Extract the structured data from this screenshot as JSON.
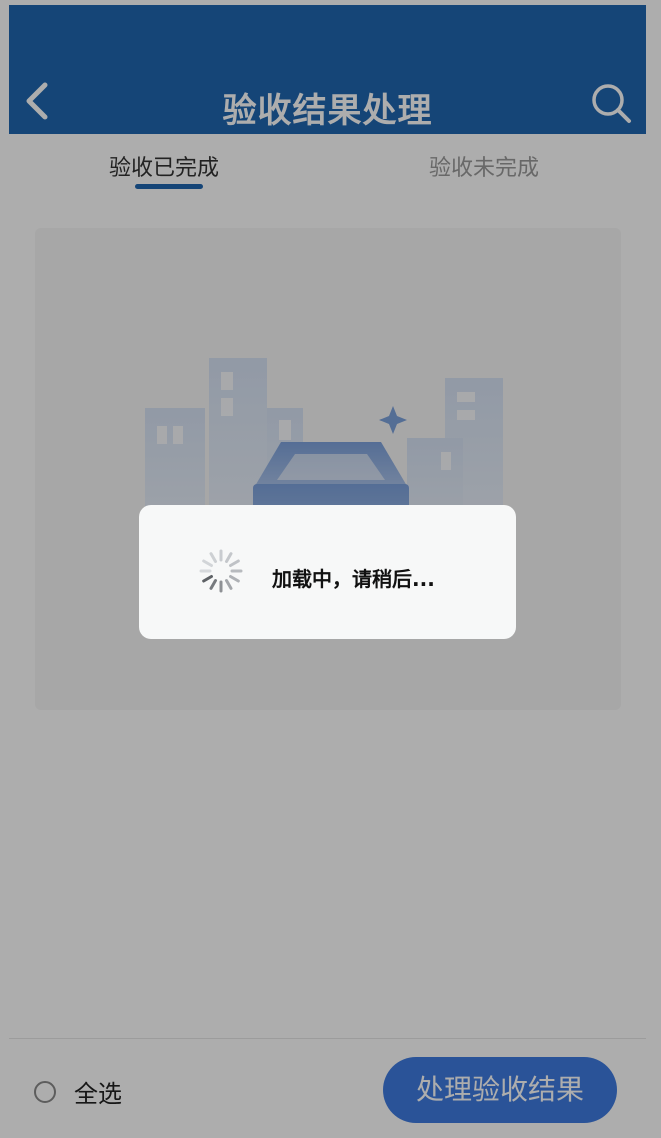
{
  "header": {
    "title": "验收结果处理",
    "back_icon": "chevron-left-icon",
    "search_icon": "search-icon",
    "color": "#2066b0"
  },
  "tabs": [
    {
      "label": "验收已完成",
      "active": true
    },
    {
      "label": "验收未完成",
      "active": false
    }
  ],
  "empty_state": {
    "illustration": "empty-inbox-buildings-illustration"
  },
  "footer": {
    "select_all_label": "全选",
    "process_button_label": "处理验收结果",
    "button_color": "#3e7be0"
  },
  "loading_toast": {
    "text": "加载中，请稍后...",
    "icon": "spinner-icon"
  }
}
